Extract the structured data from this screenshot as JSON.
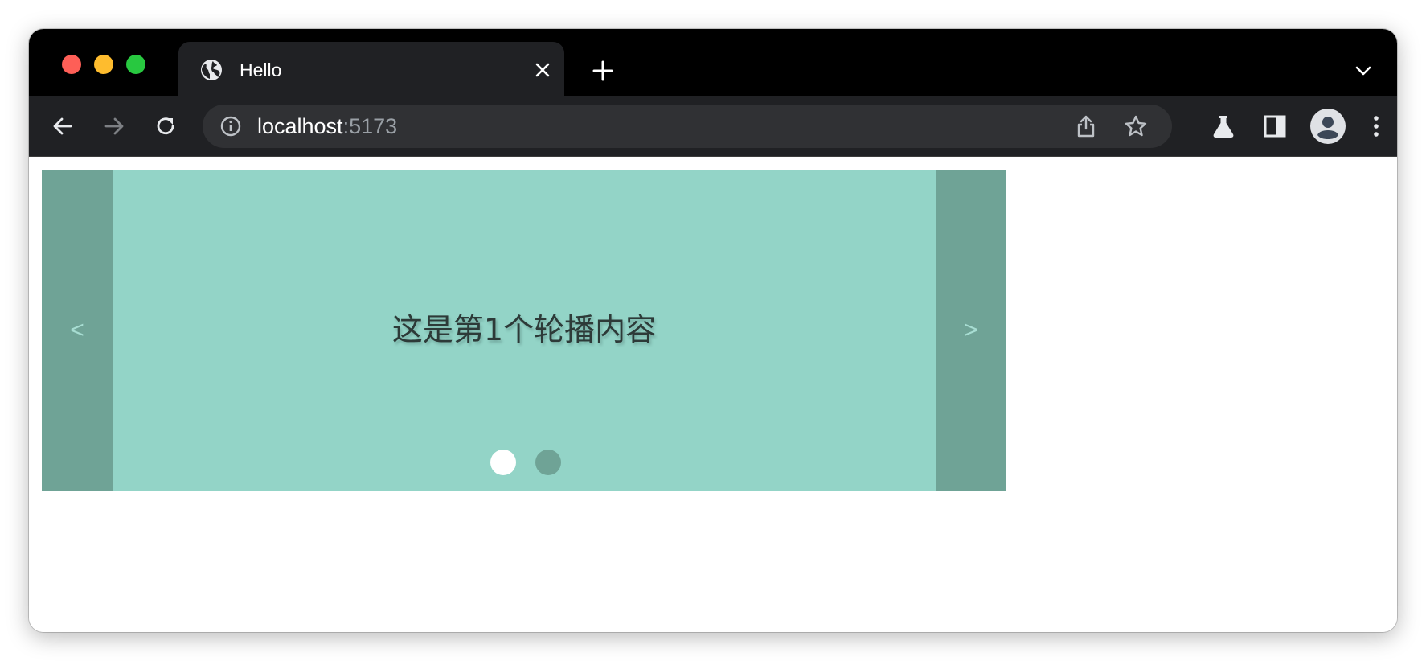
{
  "colors": {
    "tabstrip_bg": "#000000",
    "toolbar_bg": "#202124",
    "omnibox_bg": "#303134",
    "carousel_bg": "#93d4c7",
    "arrow_bg": "#6fa396",
    "dot_active": "#ffffff",
    "dot_inactive": "#6fa396"
  },
  "browser": {
    "tab": {
      "title": "Hello",
      "favicon": "globe-icon"
    },
    "address": {
      "host": "localhost",
      "port": ":5173"
    },
    "icons": [
      "back-arrow-icon",
      "forward-arrow-icon",
      "reload-icon",
      "info-icon",
      "share-icon",
      "star-icon",
      "flask-icon",
      "sidepanel-icon",
      "profile-icon",
      "kebab-menu-icon"
    ]
  },
  "carousel": {
    "prev_label": "<",
    "next_label": ">",
    "slide_text": "这是第1个轮播内容",
    "active_index": 0,
    "dot_count": 2
  }
}
